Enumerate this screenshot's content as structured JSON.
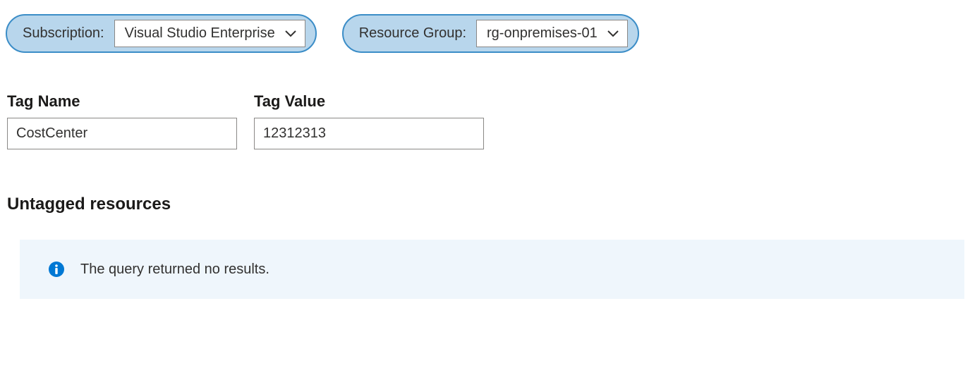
{
  "filters": {
    "subscription": {
      "label": "Subscription:",
      "value": "Visual Studio Enterprise"
    },
    "resourceGroup": {
      "label": "Resource Group:",
      "value": "rg-onpremises-01"
    }
  },
  "tagFields": {
    "name": {
      "label": "Tag Name",
      "value": "CostCenter"
    },
    "value": {
      "label": "Tag Value",
      "value": "12312313"
    }
  },
  "section": {
    "heading": "Untagged resources"
  },
  "banner": {
    "message": "The query returned no results."
  }
}
